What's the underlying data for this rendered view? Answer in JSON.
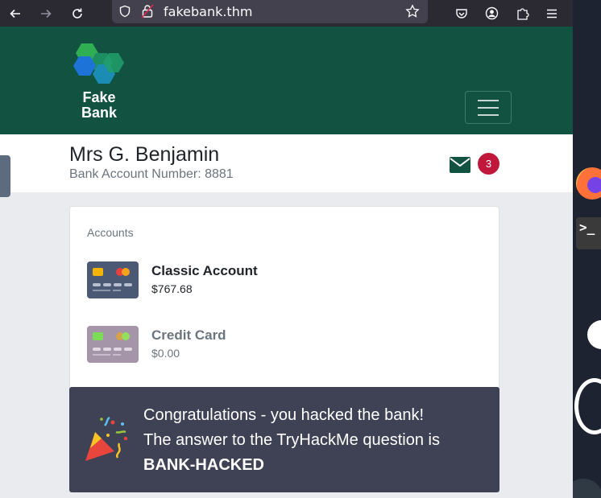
{
  "browser": {
    "url": "fakebank.thm"
  },
  "navbar": {
    "brand_line1": "Fake",
    "brand_line2": "Bank"
  },
  "user": {
    "name": "Mrs G. Benjamin",
    "account_number": "Bank Account Number: 8881",
    "unread_messages": "3"
  },
  "accounts": {
    "title": "Accounts",
    "items": [
      {
        "name": "Classic Account",
        "balance": "$767.68"
      },
      {
        "name": "Credit Card",
        "balance": "$0.00"
      }
    ]
  },
  "congrats": {
    "line1": "Congratulations - you hacked the bank!",
    "line2": "The answer to the TryHackMe question is",
    "answer": "BANK-HACKED"
  },
  "colors": {
    "navbar": "#115240",
    "badge": "#c0183a",
    "congrats_bg": "#3f4254"
  }
}
